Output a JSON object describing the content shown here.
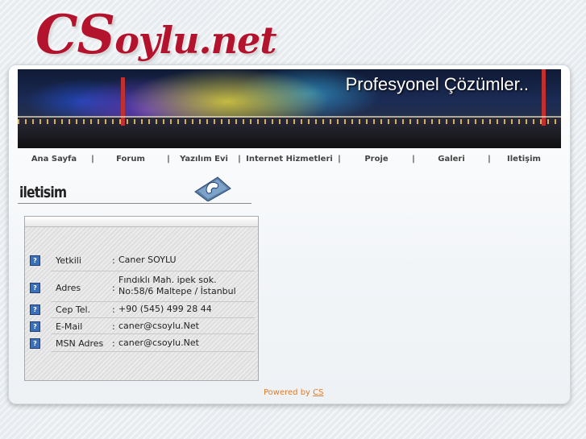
{
  "site": {
    "logo_main": "CS",
    "logo_rest": "oylu.net"
  },
  "banner": {
    "slogan": "Profesyonel Çözümler.."
  },
  "nav": {
    "items": [
      {
        "label": "Ana Sayfa"
      },
      {
        "label": "Forum"
      },
      {
        "label": "Yazılım Evi"
      },
      {
        "label": "Internet Hizmetleri"
      },
      {
        "label": "Proje"
      },
      {
        "label": "Galeri"
      },
      {
        "label": "Iletişim"
      }
    ],
    "separator": "|"
  },
  "page": {
    "title": "iletisim"
  },
  "contact": {
    "rows": [
      {
        "label": "Yetkili",
        "colon": ":",
        "value": "Caner SOYLU",
        "value2": ""
      },
      {
        "label": "Adres",
        "colon": ":",
        "value": "Fındıklı Mah. ipek sok.",
        "value2": "No:58/6 Maltepe / İstanbul"
      },
      {
        "label": "Cep Tel.",
        "colon": ":",
        "value": "+90 (545) 499 28 44",
        "value2": ""
      },
      {
        "label": "E-Mail",
        "colon": ":",
        "value": "caner@csoylu.Net",
        "value2": ""
      },
      {
        "label": "MSN Adres",
        "colon": ":",
        "value": "caner@csoylu.Net",
        "value2": ""
      }
    ],
    "row_icon": "question-icon"
  },
  "footer": {
    "powered_by": "Powered by",
    "brand": "CS"
  },
  "colors": {
    "logo": "#b3132d",
    "powered": "#e07b2a",
    "icon": "#3b6fb8"
  }
}
